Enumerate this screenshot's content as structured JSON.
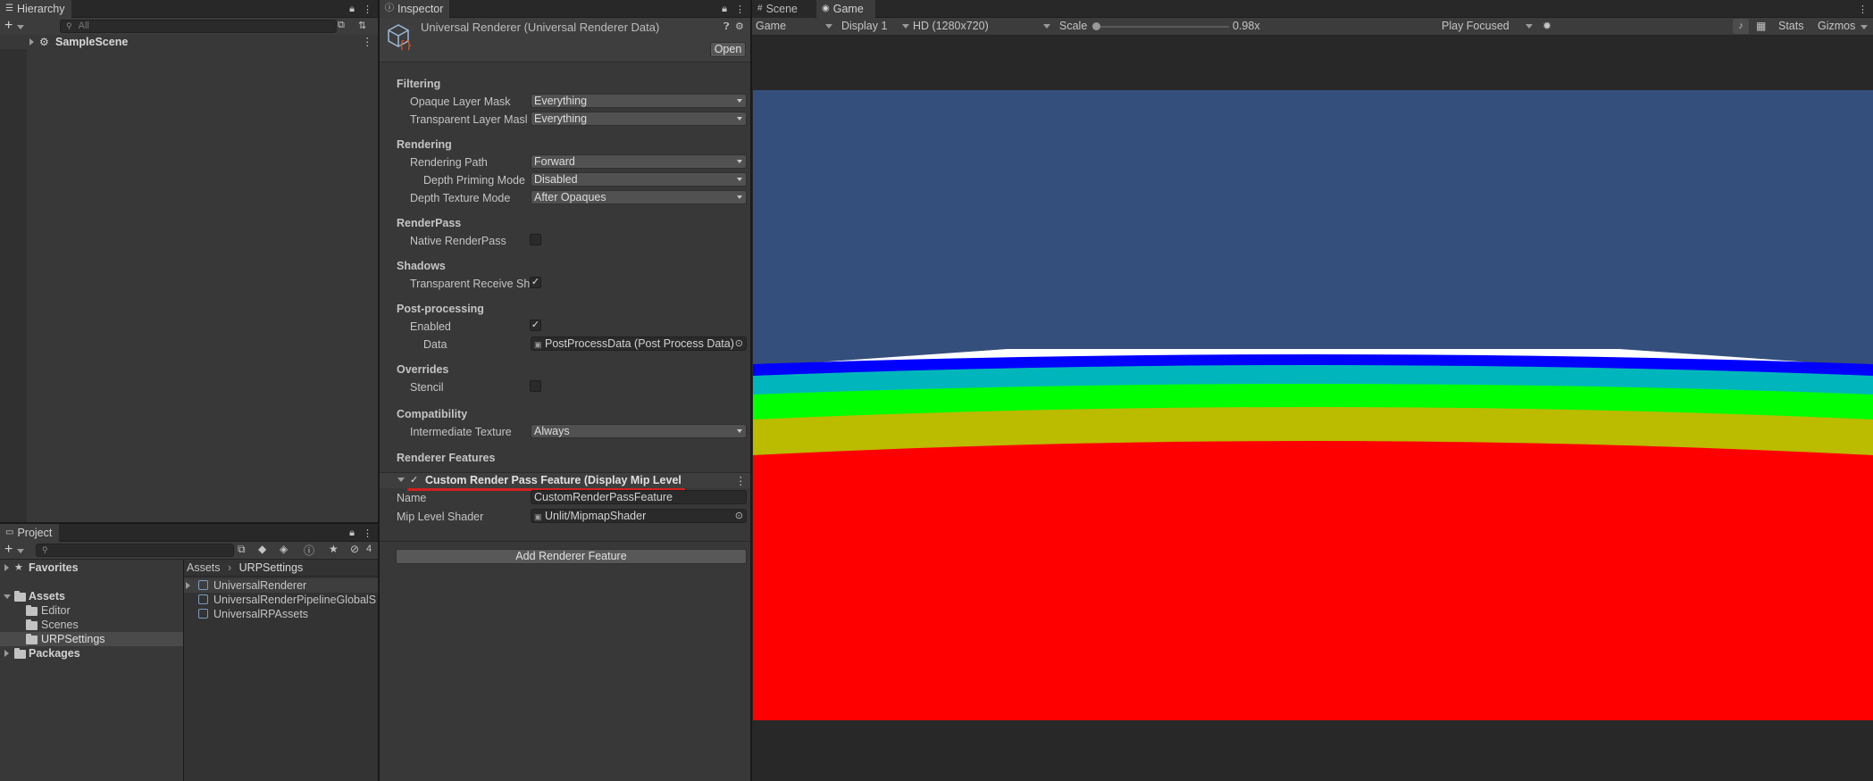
{
  "hierarchy": {
    "tab_label": "Hierarchy",
    "search_placeholder": "All",
    "scene_name": "SampleScene"
  },
  "project": {
    "tab_label": "Project",
    "hidden_count": "4",
    "tree": [
      {
        "label": "Favorites",
        "kind": "star"
      },
      {
        "label": "Assets",
        "kind": "folder-open"
      },
      {
        "label": "Editor",
        "kind": "folder"
      },
      {
        "label": "Scenes",
        "kind": "folder"
      },
      {
        "label": "URPSettings",
        "kind": "folder"
      },
      {
        "label": "Packages",
        "kind": "folder"
      }
    ],
    "breadcrumb": [
      "Assets",
      "URPSettings"
    ],
    "breadcrumb_sep": "›",
    "files": [
      "UniversalRenderer",
      "UniversalRenderPipelineGlobalS",
      "UniversalRPAssets"
    ]
  },
  "inspector": {
    "tab_label": "Inspector",
    "title": "Universal Renderer (Universal Renderer Data)",
    "open_button": "Open",
    "sections": {
      "filtering": "Filtering",
      "rendering": "Rendering",
      "renderpass": "RenderPass",
      "shadows": "Shadows",
      "postprocessing": "Post-processing",
      "overrides": "Overrides",
      "compatibility": "Compatibility",
      "renderer_features": "Renderer Features"
    },
    "fields": {
      "opaque_layer_mask": {
        "label": "Opaque Layer Mask",
        "value": "Everything"
      },
      "transparent_layer_mask": {
        "label": "Transparent Layer Masl",
        "value": "Everything"
      },
      "rendering_path": {
        "label": "Rendering Path",
        "value": "Forward"
      },
      "depth_priming_mode": {
        "label": "Depth Priming Mode",
        "value": "Disabled"
      },
      "depth_texture_mode": {
        "label": "Depth Texture Mode",
        "value": "After Opaques"
      },
      "native_renderpass": {
        "label": "Native RenderPass",
        "checked": false
      },
      "transparent_receive_shadows": {
        "label": "Transparent Receive Sh",
        "checked": true
      },
      "pp_enabled": {
        "label": "Enabled",
        "checked": true
      },
      "pp_data": {
        "label": "Data",
        "value": "PostProcessData (Post Process Data)"
      },
      "stencil": {
        "label": "Stencil",
        "checked": false
      },
      "intermediate_texture": {
        "label": "Intermediate Texture",
        "value": "Always"
      }
    },
    "feature": {
      "header": "Custom Render Pass Feature (Display Mip Level Pass I",
      "name_label": "Name",
      "name_value": "CustomRenderPassFeature",
      "shader_label": "Mip Level Shader",
      "shader_value": "Unlit/MipmapShader"
    },
    "add_feature_button": "Add Renderer Feature"
  },
  "game": {
    "tabs": [
      "Scene",
      "Game"
    ],
    "view_mode": "Game",
    "display": "Display 1",
    "resolution": "HD (1280x720)",
    "scale_label": "Scale",
    "scale_value": "0.98x",
    "play_mode": "Play Focused",
    "stats": "Stats",
    "gizmos": "Gizmos",
    "bands": [
      {
        "name": "white-band",
        "color": "#ffffff"
      },
      {
        "name": "blue-band",
        "color": "#0000ff"
      },
      {
        "name": "cyan-band",
        "color": "#00b6bc"
      },
      {
        "name": "green-band",
        "color": "#00ff00"
      },
      {
        "name": "yellow-band",
        "color": "#bbbb00"
      },
      {
        "name": "red-band",
        "color": "#ff0000"
      }
    ],
    "sky_color": "#354f7d"
  },
  "colors": {
    "accent_underline": "#d42020",
    "panel_bg": "#383838",
    "tab_bg": "#282828"
  }
}
